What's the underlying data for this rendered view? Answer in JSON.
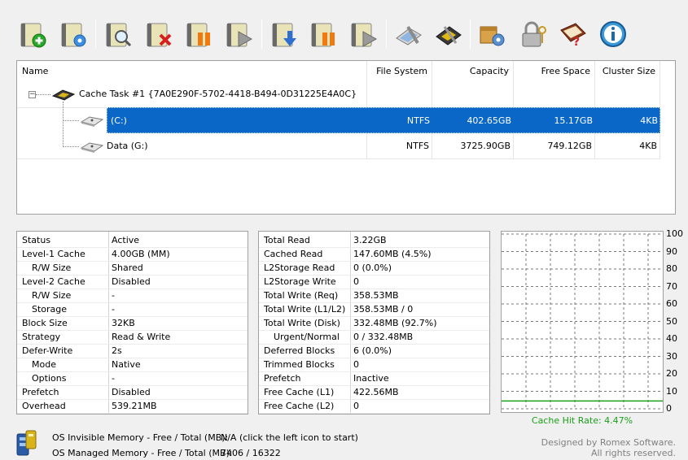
{
  "toolbar": {
    "buttons": [
      {
        "name": "add-task-button",
        "icon": "add-icon"
      },
      {
        "name": "task-settings-button",
        "icon": "gear-icon"
      },
      {
        "name": "inspect-button",
        "icon": "magnifier-icon"
      },
      {
        "name": "remove-task-button",
        "icon": "delete-icon"
      },
      {
        "name": "pause-task-button",
        "icon": "pause-icon"
      },
      {
        "name": "resume-task-button",
        "icon": "play-icon"
      },
      {
        "name": "flush-button",
        "icon": "download-arrow-icon"
      },
      {
        "name": "pause-all-button",
        "icon": "pause-icon"
      },
      {
        "name": "resume-all-button",
        "icon": "play-icon"
      },
      {
        "name": "tools-button",
        "icon": "wrench-icon"
      },
      {
        "name": "memory-button",
        "icon": "chip-icon"
      },
      {
        "name": "options-button",
        "icon": "package-gear-icon"
      },
      {
        "name": "license-button",
        "icon": "lock-key-icon"
      },
      {
        "name": "help-button",
        "icon": "help-book-icon"
      },
      {
        "name": "about-button",
        "icon": "info-icon"
      }
    ]
  },
  "tree": {
    "columns": {
      "name": "Name",
      "file_system": "File System",
      "capacity": "Capacity",
      "free_space": "Free Space",
      "cluster_size": "Cluster Size"
    },
    "task_label": "Cache Task #1 {7A0E290F-5702-4418-B494-0D31225E4A0C}",
    "drives": [
      {
        "name": "(C:)",
        "file_system": "NTFS",
        "capacity": "402.65GB",
        "free_space": "15.17GB",
        "cluster_size": "4KB"
      },
      {
        "name": "Data (G:)",
        "file_system": "NTFS",
        "capacity": "3725.90GB",
        "free_space": "749.12GB",
        "cluster_size": "4KB"
      }
    ]
  },
  "status_panel": [
    {
      "label": "Status",
      "value": "Active",
      "indent": false
    },
    {
      "label": "Level-1 Cache",
      "value": "4.00GB (MM)",
      "indent": false
    },
    {
      "label": "R/W Size",
      "value": "Shared",
      "indent": true
    },
    {
      "label": "Level-2 Cache",
      "value": "Disabled",
      "indent": false
    },
    {
      "label": "R/W Size",
      "value": "-",
      "indent": true
    },
    {
      "label": "Storage",
      "value": "-",
      "indent": true
    },
    {
      "label": "Block Size",
      "value": "32KB",
      "indent": false
    },
    {
      "label": "Strategy",
      "value": "Read & Write",
      "indent": false
    },
    {
      "label": "Defer-Write",
      "value": "2s",
      "indent": false
    },
    {
      "label": "Mode",
      "value": "Native",
      "indent": true
    },
    {
      "label": "Options",
      "value": "-",
      "indent": true
    },
    {
      "label": "Prefetch",
      "value": "Disabled",
      "indent": false
    },
    {
      "label": "Overhead",
      "value": "539.21MB",
      "indent": false
    }
  ],
  "stats_panel": [
    {
      "label": "Total Read",
      "value": "3.22GB",
      "indent": false
    },
    {
      "label": "Cached Read",
      "value": "147.60MB (4.5%)",
      "indent": false
    },
    {
      "label": "L2Storage Read",
      "value": "0 (0.0%)",
      "indent": false
    },
    {
      "label": "L2Storage Write",
      "value": "0",
      "indent": false
    },
    {
      "label": "Total Write (Req)",
      "value": "358.53MB",
      "indent": false
    },
    {
      "label": "Total Write (L1/L2)",
      "value": "358.53MB / 0",
      "indent": false
    },
    {
      "label": "Total Write (Disk)",
      "value": "332.48MB (92.7%)",
      "indent": false
    },
    {
      "label": "Urgent/Normal",
      "value": "0 / 332.48MB",
      "indent": true
    },
    {
      "label": "Deferred Blocks",
      "value": "6 (0.0%)",
      "indent": false
    },
    {
      "label": "Trimmed Blocks",
      "value": "0",
      "indent": false
    },
    {
      "label": "Prefetch",
      "value": "Inactive",
      "indent": false
    },
    {
      "label": "Free Cache (L1)",
      "value": "422.56MB",
      "indent": false
    },
    {
      "label": "Free Cache (L2)",
      "value": "0",
      "indent": false
    }
  ],
  "chart_data": {
    "type": "line",
    "title": "Cache Hit Rate: 4.47%",
    "ylim": [
      0,
      100
    ],
    "yticks": [
      "100",
      "90",
      "80",
      "70",
      "60",
      "50",
      "40",
      "30",
      "20",
      "10",
      "0"
    ],
    "series": [
      {
        "values": [
          4.47,
          4.47
        ]
      }
    ],
    "line_color": "#1aa01a",
    "grid": true
  },
  "footer": {
    "invisible_label": "OS Invisible Memory - Free / Total (MB):",
    "invisible_value": "N/A (click the left icon to start)",
    "managed_label": "OS Managed Memory - Free / Total (MB):",
    "managed_value": "7406 / 16322",
    "credit_line1": "Designed by Romex Software.",
    "credit_line2": "All rights reserved."
  }
}
